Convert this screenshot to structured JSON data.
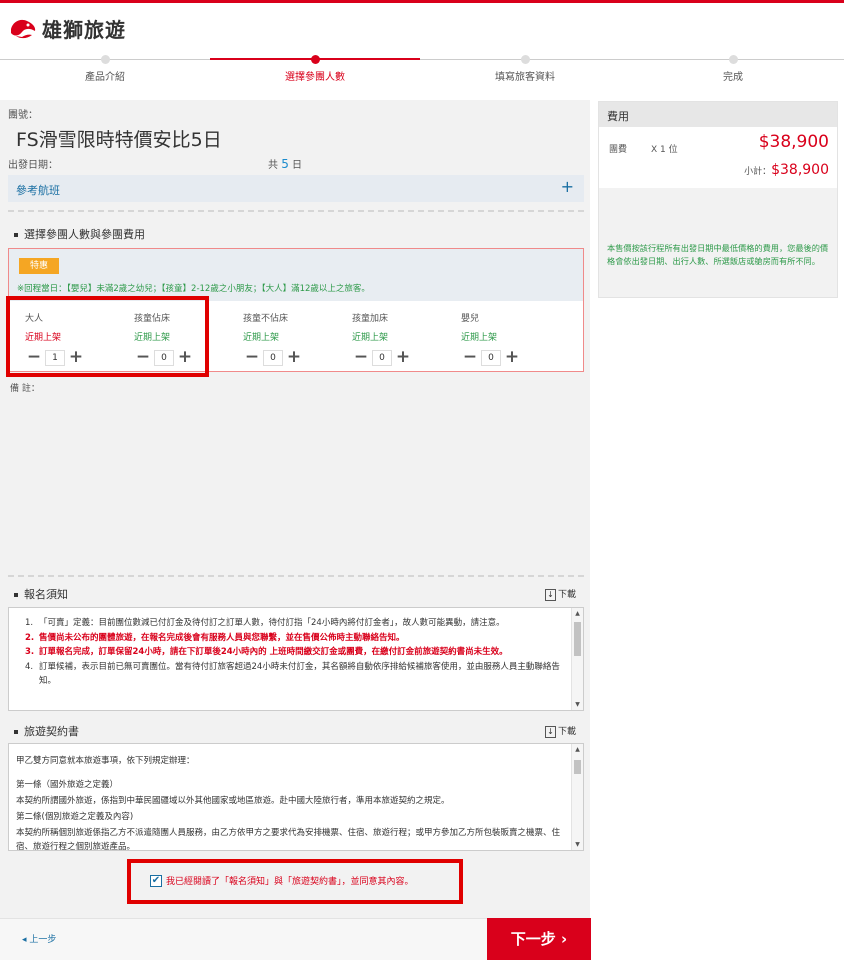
{
  "brand": {
    "name": "雄獅旅遊"
  },
  "steps": [
    {
      "label": "產品介紹",
      "active": false
    },
    {
      "label": "選擇參團人數",
      "active": true
    },
    {
      "label": "填寫旅客資料",
      "active": false
    },
    {
      "label": "完成",
      "active": false
    }
  ],
  "tour": {
    "no_label": "團號：",
    "title": "FS滑雪限時特價安比5日",
    "date_label": "出發日期：",
    "days_prefix": "共",
    "days_value": "5",
    "days_suffix": "日",
    "ref_flight": "參考航班",
    "ref_plus": "+"
  },
  "pax_section": {
    "title": "選擇參團人數與參團費用",
    "badge": "特惠",
    "note": "※回程當日：【嬰兒】未滿2歲之幼兒；【孩童】2-12歲之小朋友；【大人】滿12歲以上之旅客。",
    "columns": [
      {
        "name": "大人",
        "status": "近期上架",
        "status_color": "red",
        "value": "1"
      },
      {
        "name": "孩童佔床",
        "status": "近期上架",
        "status_color": "green",
        "value": "0"
      },
      {
        "name": "孩童不佔床",
        "status": "近期上架",
        "status_color": "green",
        "value": "0"
      },
      {
        "name": "孩童加床",
        "status": "近期上架",
        "status_color": "green",
        "value": "0"
      },
      {
        "name": "嬰兒",
        "status": "近期上架",
        "status_color": "green",
        "value": "0"
      }
    ],
    "minus": "−",
    "plus": "+"
  },
  "remark_label": "備 註：",
  "notice": {
    "title": "報名須知",
    "download": "下載",
    "items": [
      {
        "n": "1.",
        "text": "「可賣」定義：目前團位數減已付訂金及待付訂之訂單人數，待付訂指「24小時內將付訂金者」，故人數可能異動，請注意。",
        "red": false
      },
      {
        "n": "2.",
        "text": "售價尚未公布的團體旅遊，在報名完成後會有服務人員與您聯繫，並在售價公佈時主動聯絡告知。",
        "red": true
      },
      {
        "n": "3.",
        "text": "訂單報名完成，訂單保留24小時，請在下訂單後24小時內的 上班時間繳交訂金或團費，在繳付訂金前旅遊契約書尚未生效。",
        "red": true
      },
      {
        "n": "4.",
        "text": "訂單候補，表示目前已無可賣團位。當有待付訂旅客超過24小時未付訂金，其名額將自動依序排給候補旅客使用，並由服務人員主動聯絡告知。",
        "red": false
      }
    ]
  },
  "contract": {
    "title": "旅遊契約書",
    "download": "下載",
    "lines": [
      "甲乙雙方同意就本旅遊事項，依下列規定辦理：",
      "",
      "第一條（國外旅遊之定義）",
      "本契約所謂國外旅遊，係指到中華民國疆域以外其他國家或地區旅遊。赴中國大陸旅行者，準用本旅遊契約之規定。",
      "第二條(個別旅遊之定義及內容)",
      "本契約所稱個別旅遊係指乙方不派遣隨團人員服務，由乙方依甲方之要求代為安排機票、住宿、旅遊行程；或甲方參加乙方所包裝販賣之機票、住宿、旅遊行程之個別旅遊產品。"
    ]
  },
  "agree": {
    "checked": true,
    "check_mark": "✔",
    "text": "我已經閱讀了「報名須知」與「旅遊契約書」，並同意其內容。"
  },
  "nav": {
    "prev": "上一步",
    "prev_arrow": "◂",
    "next": "下一步",
    "next_arrow": "›"
  },
  "fee": {
    "title": "費用",
    "item": "團費",
    "qty": "X 1 位",
    "price": "$38,900",
    "subtotal_label": "小計：",
    "subtotal": "$38,900",
    "note": "本售價按該行程所有出發日期中最低價格的費用，您最後的價格會依出發日期、出行人數、所選飯店或艙房而有所不同。"
  },
  "colors": {
    "brand_red": "#d9001b",
    "link_blue": "#1a6fa3",
    "note_green": "#2e9a4a",
    "badge_orange": "#f5a623"
  }
}
